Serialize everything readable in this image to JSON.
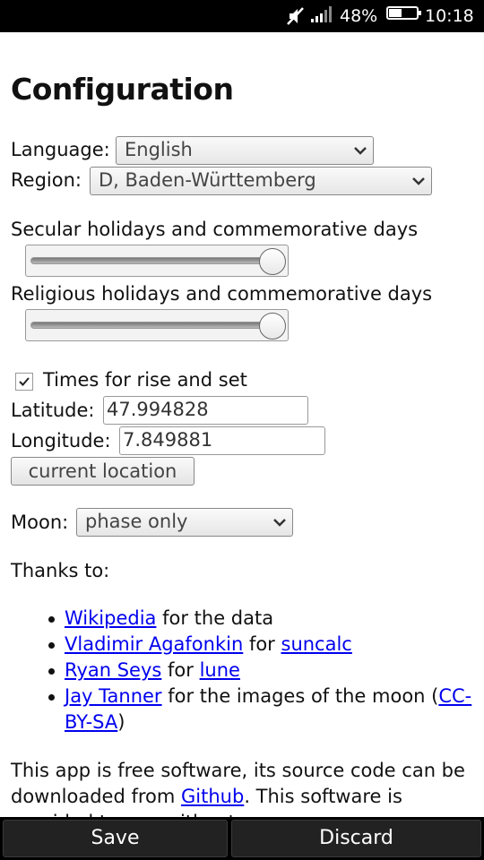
{
  "status_bar": {
    "battery_percent": "48%",
    "time": "10:18",
    "icons": [
      "mute-icon",
      "signal-icon",
      "battery-icon"
    ]
  },
  "page": {
    "title": "Configuration"
  },
  "form": {
    "language_label": "Language:",
    "language_value": "English",
    "region_label": "Region:",
    "region_value": "D, Baden-Württemberg",
    "secular_label": "Secular holidays and commemorative days",
    "secular_slider_level": 1.0,
    "religious_label": "Religious holidays and commemorative days",
    "religious_slider_level": 1.0,
    "rise_set_checked": true,
    "rise_set_label": "Times for rise and set",
    "latitude_label": "Latitude:",
    "latitude_value": "47.994828",
    "longitude_label": "Longitude:",
    "longitude_value": "7.849881",
    "current_location_label": "current location",
    "moon_label": "Moon:",
    "moon_value": "phase only"
  },
  "thanks": {
    "heading": "Thanks to:",
    "items": [
      {
        "link1": "Wikipedia",
        "text1": " for the data"
      },
      {
        "link1": "Vladimir Agafonkin",
        "text1": " for ",
        "link2": "suncalc"
      },
      {
        "link1": "Ryan Seys",
        "text1": " for ",
        "link2": "lune"
      },
      {
        "link1": "Jay Tanner",
        "text1": " for the images of the moon (",
        "link2": "CC-BY-SA",
        "text2": ")"
      }
    ]
  },
  "footer_text": {
    "part1": "This app is free software, its source code can be downloaded from ",
    "link": "Github",
    "part2": ". This software is provided to you without any"
  },
  "bottom_bar": {
    "save_label": "Save",
    "discard_label": "Discard"
  },
  "colors": {
    "link": "#0000ee",
    "bar_background": "#000000"
  }
}
